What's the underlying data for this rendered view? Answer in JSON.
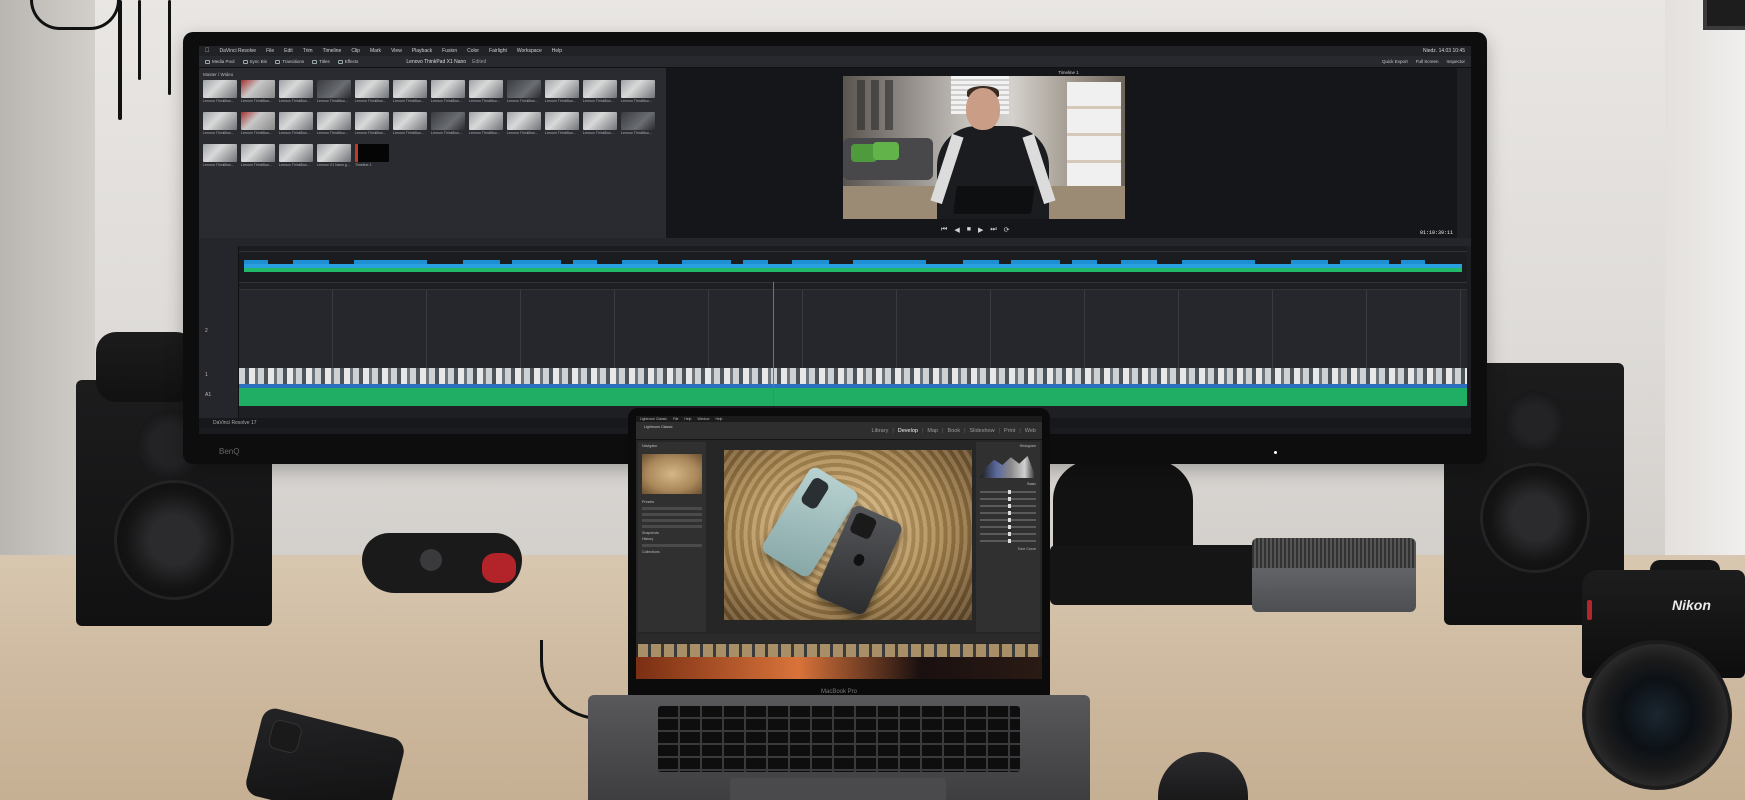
{
  "monitor": {
    "brand": "BenQ",
    "menubar": {
      "items": [
        "DaVinci Resolve",
        "File",
        "Edit",
        "Trim",
        "Timeline",
        "Clip",
        "Mark",
        "View",
        "Playback",
        "Fusion",
        "Color",
        "Fairlight",
        "Workspace",
        "Help"
      ],
      "status": "Niedz. 14.03 10:45"
    },
    "toolbar": {
      "buttons": [
        "Media Pool",
        "Sync Bin",
        "Transitions",
        "Titles",
        "Effects"
      ],
      "project_title": "Lenovo ThinkPad X1 Nano",
      "project_state": "Edited",
      "right_buttons": [
        "Quick Export",
        "Full Screen",
        "Inspector"
      ]
    },
    "media_pool": {
      "title": "Master / Wideo",
      "search_label": "Search",
      "clips": [
        "Lenovo ThinkBoo...",
        "Lenovo ThinkBoo...",
        "Lenovo ThinkBoo...",
        "Lenovo ThinkBoo...",
        "Lenovo ThinkBoo...",
        "Lenovo ThinkBoo...",
        "Lenovo ThinkBoo...",
        "Lenovo ThinkBoo...",
        "Lenovo ThinkBoo...",
        "Lenovo ThinkBoo...",
        "Lenovo ThinkBoo...",
        "Lenovo ThinkBoo...",
        "Lenovo ThinkBoo...",
        "Lenovo ThinkBoo...",
        "Lenovo ThinkBoo...",
        "Lenovo ThinkBoo...",
        "Lenovo ThinkBoo...",
        "Lenovo ThinkBoo...",
        "Lenovo ThinkBoo...",
        "Lenovo ThinkBoo...",
        "Lenovo ThinkBoo...",
        "Lenovo ThinkBoo...",
        "Lenovo ThinkBoo...",
        "Lenovo ThinkBoo...",
        "Lenovo ThinkBoo...",
        "Lenovo ThinkBoo...",
        "Lenovo ThinkBoo...",
        "Lenovo X1 Nano g...",
        "Timeline 1"
      ]
    },
    "viewer": {
      "timeline_label": "Timeline 1",
      "timecode": "01:10:39:11"
    },
    "timeline": {
      "track_labels": [
        "2",
        "1",
        "A1"
      ],
      "status": "DaVinci Resolve 17"
    }
  },
  "laptop": {
    "app_name": "Lightroom Classic",
    "menubar": [
      "Lightroom Classic",
      "File",
      "Help",
      "Window",
      "Help"
    ],
    "modules": [
      "Library",
      "Develop",
      "Map",
      "Book",
      "Slideshow",
      "Print",
      "Web"
    ],
    "active_module": "Develop",
    "left_panel_labels": [
      "Navigator",
      "Presets",
      "Snapshots",
      "History",
      "Collections"
    ],
    "right_panel_labels": [
      "Histogram",
      "Basic",
      "Tone Curve"
    ],
    "toolbar_text": "Soft Proofing",
    "label": "MacBook Pro"
  },
  "camera": {
    "brand": "Nikon"
  },
  "colors": {
    "resolve_clip_blue": "#1d8fd2",
    "resolve_audio_green": "#1fae63",
    "playhead_red": "#e0473a"
  }
}
